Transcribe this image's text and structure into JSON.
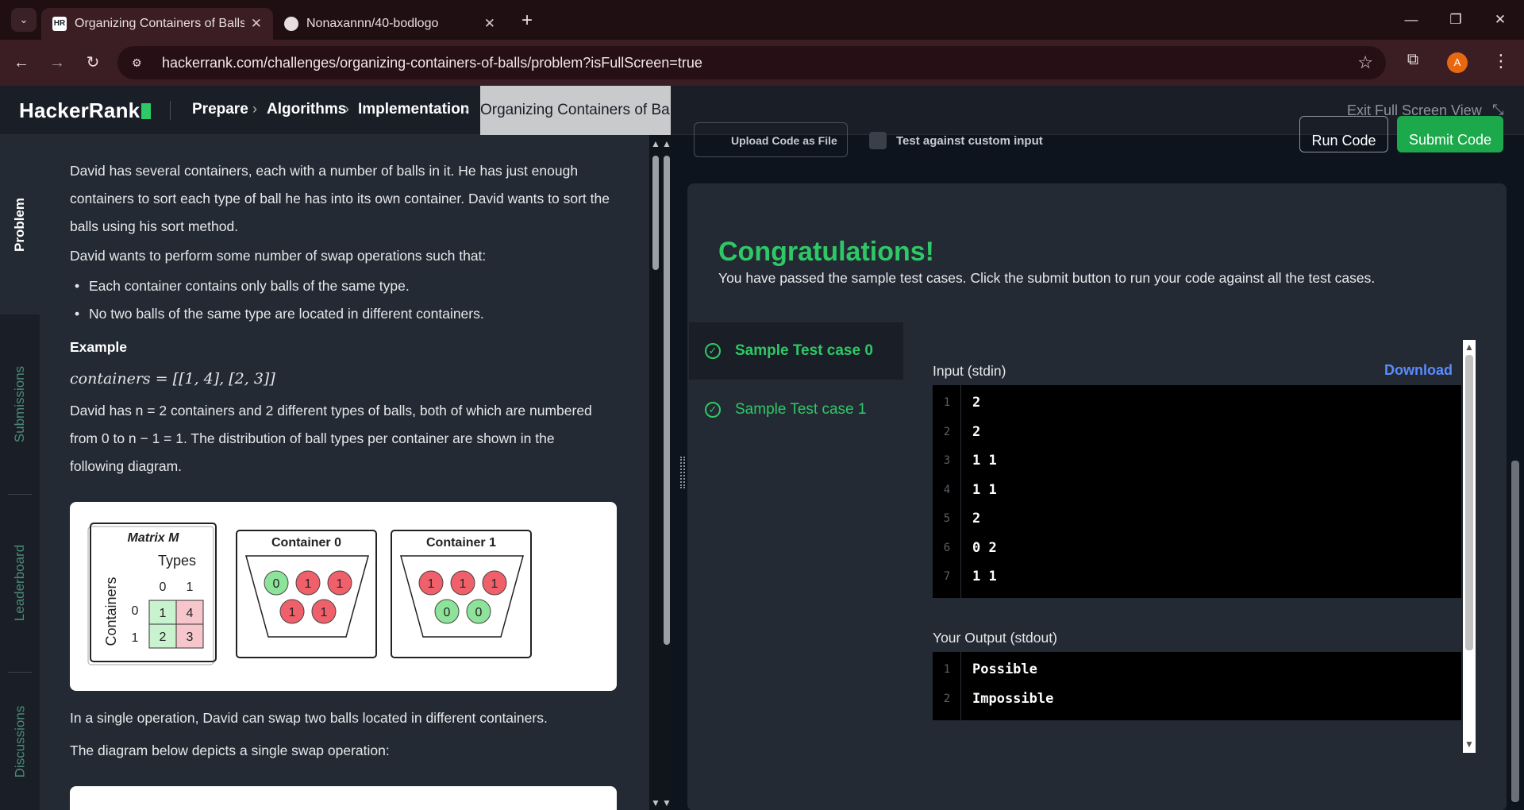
{
  "browser": {
    "tabs": [
      {
        "title": "Organizing Containers of Balls | HackerRank",
        "favicon": "hackerrank-favicon",
        "active": true
      },
      {
        "title": "Nonaxannn/40-bodlogo",
        "favicon": "github-icon",
        "active": false
      }
    ],
    "url": "hackerrank.com/challenges/organizing-containers-of-balls/problem?isFullScreen=true",
    "profile_initial": "A"
  },
  "header": {
    "logo": "HackerRank",
    "breadcrumbs": [
      "Prepare",
      "Algorithms",
      "Implementation"
    ],
    "current": "Organizing Containers of Balls",
    "exit_full_screen": "Exit Full Screen View"
  },
  "side_tabs": [
    "Problem",
    "Submissions",
    "Leaderboard",
    "Discussions"
  ],
  "problem": {
    "intro": "David has several containers, each with a number of balls in it. He has just enough containers to sort each type of ball he has into its own container. David wants to sort the balls using his sort method.",
    "swap_intro": "David wants to perform some number of swap operations such that:",
    "bullets": [
      "Each container contains only balls of the same type.",
      "No two balls of the same type are located in different containers."
    ],
    "example_heading": "Example",
    "example_formula": "containers = [[1, 4], [2, 3]]",
    "example_text_1": "David has n = 2 containers and 2 different types of balls, both of which are numbered",
    "example_text_2": "from 0 to n − 1 = 1. The distribution of ball types per container are shown in the",
    "example_text_3": "following diagram.",
    "diagram": {
      "matrix_title": "Matrix M",
      "types_label": "Types",
      "containers_label": "Containers",
      "col_headers": [
        "0",
        "1"
      ],
      "row_headers": [
        "0",
        "1"
      ],
      "cells": [
        [
          "1",
          "4"
        ],
        [
          "2",
          "3"
        ]
      ],
      "container0_title": "Container 0",
      "container0_top": [
        "0",
        "1",
        "1"
      ],
      "container0_bottom": [
        "1",
        "1"
      ],
      "container1_title": "Container 1",
      "container1_top": [
        "1",
        "1",
        "1"
      ],
      "container1_bottom": [
        "0",
        "0"
      ]
    },
    "single_op": "In a single operation, David can swap two balls located in different containers.",
    "diagram_caption": "The diagram below depicts a single swap operation:"
  },
  "editor": {
    "upload_label": "Upload Code as File",
    "custom_input_label": "Test against custom input",
    "run_label": "Run Code",
    "submit_label": "Submit Code"
  },
  "results": {
    "title": "Congratulations!",
    "message": "You have passed the sample test cases. Click the submit button to run your code against all the test cases.",
    "test_cases": [
      "Sample Test case 0",
      "Sample Test case 1"
    ],
    "input_label": "Input (stdin)",
    "download_label": "Download",
    "input_lines": [
      "2",
      "2",
      "1 1",
      "1 1",
      "2",
      "0 2",
      "1 1"
    ],
    "input_line_numbers": [
      "1",
      "2",
      "3",
      "4",
      "5",
      "6",
      "7"
    ],
    "output_label": "Your Output (stdout)",
    "output_lines": [
      "Possible",
      "Impossible"
    ],
    "output_line_numbers": [
      "1",
      "2"
    ]
  },
  "colors": {
    "accent_green": "#2ec866",
    "ball_red": "#f0606b",
    "ball_green": "#8ee39a",
    "link_blue": "#5c8bff"
  }
}
